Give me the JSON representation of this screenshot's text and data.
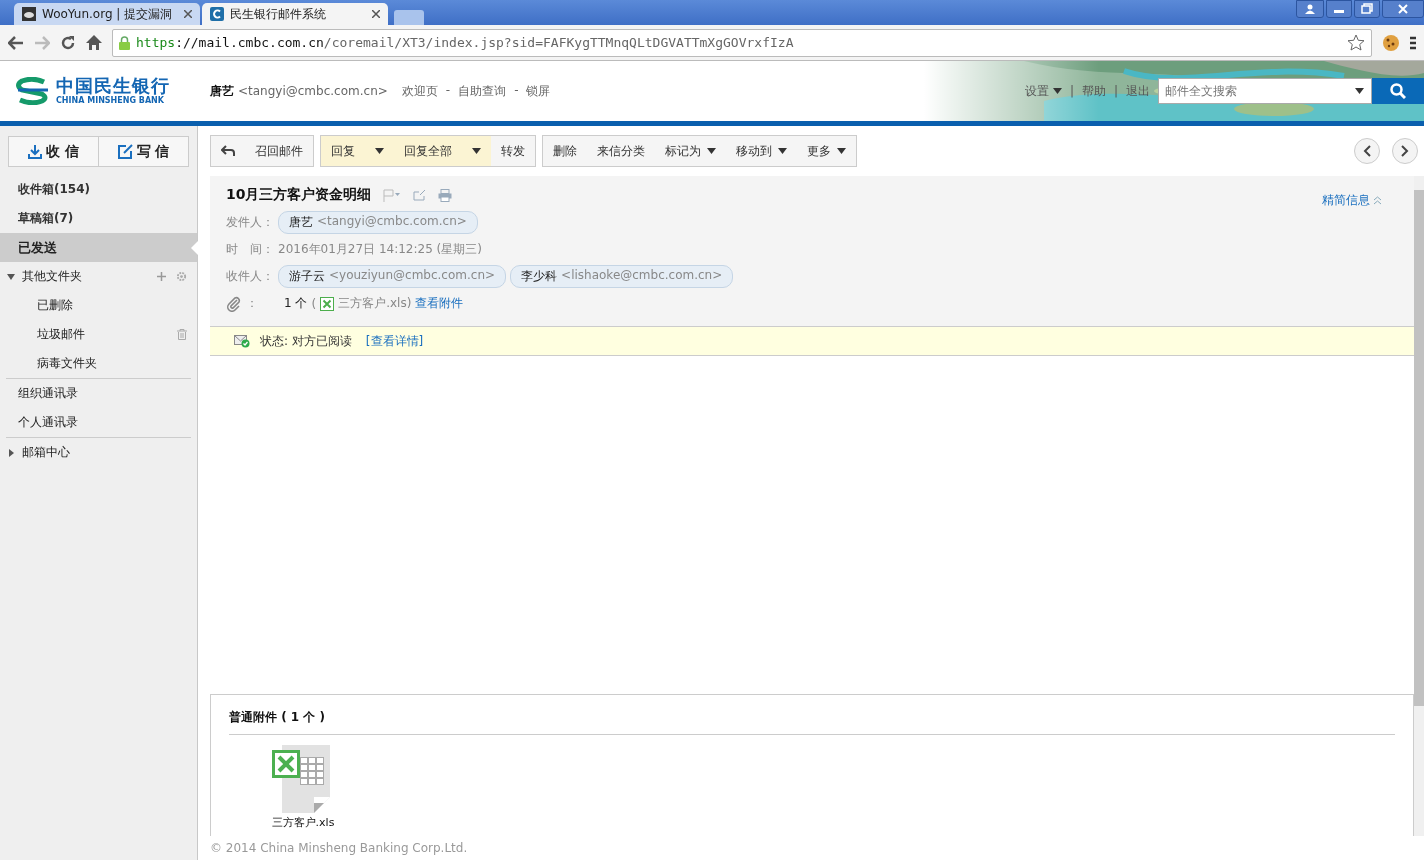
{
  "browser": {
    "tabs": [
      {
        "title": "WooYun.org | 提交漏洞",
        "selected": false
      },
      {
        "title": "民生银行邮件系统",
        "selected": true
      }
    ],
    "url": {
      "scheme": "https",
      "host": "://mail.cmbc.com.cn",
      "path": "/coremail/XT3/index.jsp?sid=FAFKygTTMnqQLtDGVATTmXgGOVrxfIzA"
    }
  },
  "header": {
    "logo": {
      "cn": "中国民生银行",
      "en": "CHINA MINSHENG BANK"
    },
    "user": {
      "name": "唐艺",
      "email": "<tangyi@cmbc.com.cn>"
    },
    "links": [
      "欢迎页",
      "自助查询",
      "锁屏"
    ],
    "link_separator": "-",
    "right_links": [
      "设置",
      "帮助",
      "退出"
    ],
    "right_separator": "|",
    "search": {
      "placeholder": "邮件全文搜索"
    }
  },
  "sidebar": {
    "buttons": [
      {
        "label": "收 信",
        "kind": "receive"
      },
      {
        "label": "写 信",
        "kind": "compose"
      }
    ],
    "sections": [
      [
        {
          "label": "收件箱",
          "count": "(154)",
          "selected": false
        },
        {
          "label": "草稿箱",
          "count": "(7)",
          "selected": false
        },
        {
          "label": "已发送",
          "selected": true
        },
        {
          "label": "其他文件夹",
          "selected": false,
          "expanded": true,
          "children": [
            {
              "label": "已删除",
              "selected": false
            },
            {
              "label": "垃圾邮件",
              "selected": false,
              "kind": "trash"
            },
            {
              "label": "病毒文件夹",
              "selected": false
            }
          ]
        }
      ],
      [
        {
          "label": "组织通讯录",
          "selected": false
        },
        {
          "label": "个人通讯录",
          "selected": false
        }
      ],
      [
        {
          "label": "邮箱中心",
          "selected": false,
          "expanded": false
        }
      ]
    ]
  },
  "toolbar": [
    [
      {
        "kind": "back"
      },
      {
        "kind": "text",
        "label": "召回邮件"
      }
    ],
    [
      {
        "kind": "text",
        "label": "回复",
        "highlighted": true,
        "split": true
      },
      {
        "kind": "text",
        "label": "回复全部",
        "highlighted": true,
        "split": true
      },
      {
        "kind": "text",
        "label": "转发",
        "highlighted": false
      }
    ],
    [
      {
        "kind": "text",
        "label": "删除"
      },
      {
        "kind": "text",
        "label": "来信分类"
      },
      {
        "kind": "menu",
        "label": "标记为"
      },
      {
        "kind": "menu",
        "label": "移动到"
      },
      {
        "kind": "menu",
        "label": "更多"
      }
    ]
  ],
  "message": {
    "subject": "10月三方客户资金明细",
    "details_toggle": "精简信息",
    "sender_label": "发件人：",
    "sender": {
      "name": "唐艺",
      "email": "<tangyi@cmbc.com.cn>"
    },
    "time_label": "时　间：",
    "time": "2016年01月27日 14:12:25 (星期三)",
    "recipients_label": "收件人：",
    "recipients": [
      {
        "name": "游子云",
        "email": "<youziyun@cmbc.com.cn>"
      },
      {
        "name": "李少科",
        "email": "<lishaoke@cmbc.com.cn>"
      }
    ],
    "attachment_label": "：",
    "attachment_count": "1 个",
    "attachment_open": "(",
    "attachment_name": "三方客户.xls)",
    "attachment_link": "查看附件"
  },
  "status": {
    "text": "状态: 对方已阅读",
    "link": "[查看详情]"
  },
  "attachments": {
    "title": "普通附件 ( 1 个 )",
    "files": [
      {
        "name": "三方客户.xls"
      }
    ]
  },
  "footer": "© 2014 China Minsheng Banking Corp.Ltd."
}
